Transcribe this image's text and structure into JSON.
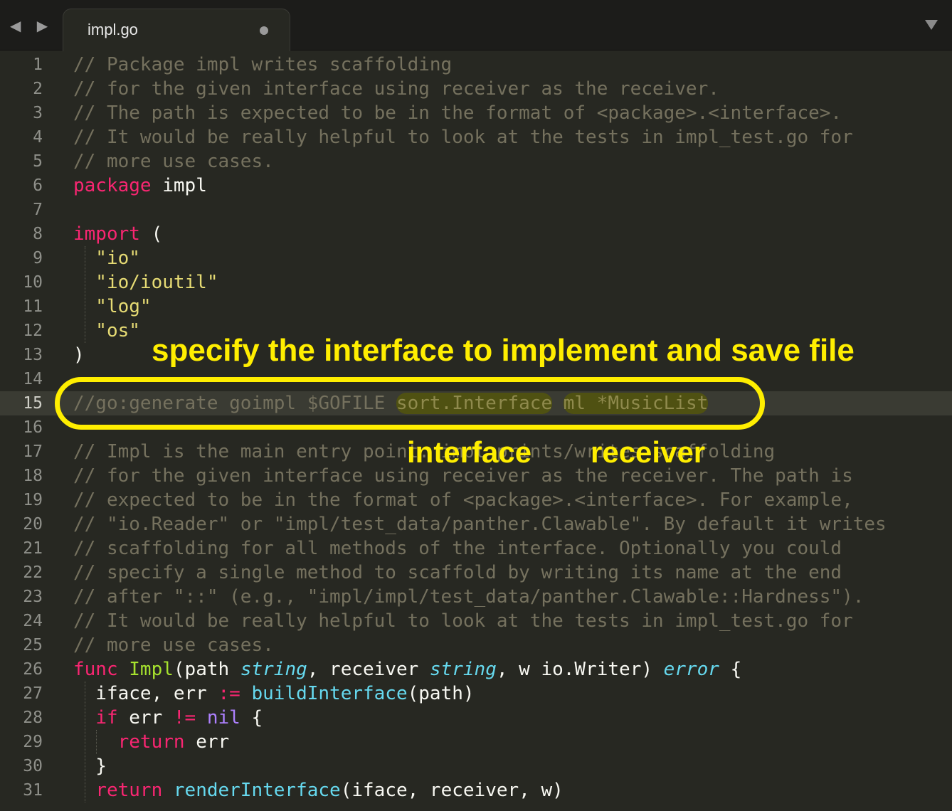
{
  "tab": {
    "title": "impl.go",
    "nav_arrows": "◀ ▶",
    "modified_indicator": "dot-icon",
    "menu_icon": "chevron-down-icon"
  },
  "annotations": {
    "heading": "specify the interface to implement and save file",
    "interface_label": "interface",
    "receiver_label": "receiver",
    "highlight_color": "#ffee00"
  },
  "editor": {
    "active_line": 15,
    "lines": [
      {
        "n": "1",
        "tokens": [
          {
            "c": "c",
            "t": "// Package impl writes scaffolding"
          }
        ]
      },
      {
        "n": "2",
        "tokens": [
          {
            "c": "c",
            "t": "// for the given interface using receiver as the receiver."
          }
        ]
      },
      {
        "n": "3",
        "tokens": [
          {
            "c": "c",
            "t": "// The path is expected to be in the format of <package>.<interface>."
          }
        ]
      },
      {
        "n": "4",
        "tokens": [
          {
            "c": "c",
            "t": "// It would be really helpful to look at the tests in impl_test.go for"
          }
        ]
      },
      {
        "n": "5",
        "tokens": [
          {
            "c": "c",
            "t": "// more use cases."
          }
        ]
      },
      {
        "n": "6",
        "tokens": [
          {
            "c": "k",
            "t": "package"
          },
          {
            "c": "",
            "t": " impl"
          }
        ]
      },
      {
        "n": "7",
        "tokens": []
      },
      {
        "n": "8",
        "tokens": [
          {
            "c": "k",
            "t": "import"
          },
          {
            "c": "",
            "t": " ("
          }
        ]
      },
      {
        "n": "9",
        "tokens": [
          {
            "c": "s",
            "t": "  \"io\""
          }
        ]
      },
      {
        "n": "10",
        "tokens": [
          {
            "c": "s",
            "t": "  \"io/ioutil\""
          }
        ]
      },
      {
        "n": "11",
        "tokens": [
          {
            "c": "s",
            "t": "  \"log\""
          }
        ]
      },
      {
        "n": "12",
        "tokens": [
          {
            "c": "s",
            "t": "  \"os\""
          }
        ]
      },
      {
        "n": "13",
        "tokens": [
          {
            "c": "",
            "t": ")"
          }
        ]
      },
      {
        "n": "14",
        "tokens": []
      },
      {
        "n": "15",
        "tokens": [
          {
            "c": "c",
            "t": "//go:generate goimpl $GOFILE "
          },
          {
            "c": "hl",
            "t": "sort.Interface"
          },
          {
            "c": "c",
            "t": " "
          },
          {
            "c": "hl",
            "t": "ml *MusicList"
          }
        ]
      },
      {
        "n": "16",
        "tokens": []
      },
      {
        "n": "17",
        "tokens": [
          {
            "c": "c",
            "t": "// Impl is the main entry point. impl prints/writes scaffolding"
          }
        ]
      },
      {
        "n": "18",
        "tokens": [
          {
            "c": "c",
            "t": "// for the given interface using receiver as the receiver. The path is"
          }
        ]
      },
      {
        "n": "19",
        "tokens": [
          {
            "c": "c",
            "t": "// expected to be in the format of <package>.<interface>. For example,"
          }
        ]
      },
      {
        "n": "20",
        "tokens": [
          {
            "c": "c",
            "t": "// \"io.Reader\" or \"impl/test_data/panther.Clawable\". By default it writes"
          }
        ]
      },
      {
        "n": "21",
        "tokens": [
          {
            "c": "c",
            "t": "// scaffolding for all methods of the interface. Optionally you could"
          }
        ]
      },
      {
        "n": "22",
        "tokens": [
          {
            "c": "c",
            "t": "// specify a single method to scaffold by writing its name at the end"
          }
        ]
      },
      {
        "n": "23",
        "tokens": [
          {
            "c": "c",
            "t": "// after \"::\" (e.g., \"impl/impl/test_data/panther.Clawable::Hardness\")."
          }
        ]
      },
      {
        "n": "24",
        "tokens": [
          {
            "c": "c",
            "t": "// It would be really helpful to look at the tests in impl_test.go for"
          }
        ]
      },
      {
        "n": "25",
        "tokens": [
          {
            "c": "c",
            "t": "// more use cases."
          }
        ]
      },
      {
        "n": "26",
        "tokens": [
          {
            "c": "k",
            "t": "func"
          },
          {
            "c": "",
            "t": " "
          },
          {
            "c": "f",
            "t": "Impl"
          },
          {
            "c": "",
            "t": "(path "
          },
          {
            "c": "t",
            "t": "string"
          },
          {
            "c": "",
            "t": ", receiver "
          },
          {
            "c": "t",
            "t": "string"
          },
          {
            "c": "",
            "t": ", w io.Writer) "
          },
          {
            "c": "t",
            "t": "error"
          },
          {
            "c": "",
            "t": " {"
          }
        ]
      },
      {
        "n": "27",
        "tokens": [
          {
            "c": "",
            "t": "  iface, err "
          },
          {
            "c": "k",
            "t": ":="
          },
          {
            "c": "",
            "t": " "
          },
          {
            "c": "b",
            "t": "buildInterface"
          },
          {
            "c": "",
            "t": "(path)"
          }
        ]
      },
      {
        "n": "28",
        "tokens": [
          {
            "c": "",
            "t": "  "
          },
          {
            "c": "k",
            "t": "if"
          },
          {
            "c": "",
            "t": " err "
          },
          {
            "c": "k",
            "t": "!="
          },
          {
            "c": "",
            "t": " "
          },
          {
            "c": "n",
            "t": "nil"
          },
          {
            "c": "",
            "t": " {"
          }
        ]
      },
      {
        "n": "29",
        "tokens": [
          {
            "c": "",
            "t": "    "
          },
          {
            "c": "k",
            "t": "return"
          },
          {
            "c": "",
            "t": " err"
          }
        ]
      },
      {
        "n": "30",
        "tokens": [
          {
            "c": "",
            "t": "  }"
          }
        ]
      },
      {
        "n": "31",
        "tokens": [
          {
            "c": "",
            "t": "  "
          },
          {
            "c": "k",
            "t": "return"
          },
          {
            "c": "",
            "t": " "
          },
          {
            "c": "b",
            "t": "renderInterface"
          },
          {
            "c": "",
            "t": "(iface, receiver, w)"
          }
        ]
      }
    ]
  }
}
